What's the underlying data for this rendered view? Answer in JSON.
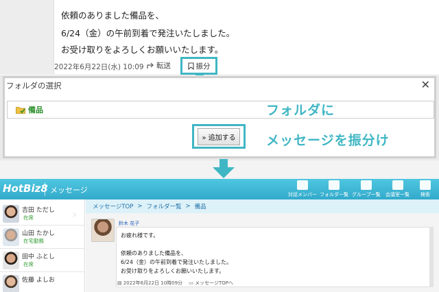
{
  "top_message": {
    "lines": [
      "依頼のありました備品を、",
      "6/24（金）の午前到着で発注いたしました。",
      "お受け取りをよろしくお願いいたします。"
    ],
    "date": "2022年6月22日(水) 10:09",
    "forward_label": "転送",
    "assign_label": "振分"
  },
  "dialog": {
    "title": "フォルダの選択",
    "close_symbol": "✕",
    "folder_name": "備品",
    "add_button": "» 追加する"
  },
  "overlay": {
    "line1": "フォルダに",
    "line2": "メッセージを振分け"
  },
  "app": {
    "logo": "HotBiz8",
    "section_title": "メッセージ",
    "nav": [
      {
        "label": "対話メンバー",
        "icon": "person-icon"
      },
      {
        "label": "フォルダ一覧",
        "icon": "folder-icon"
      },
      {
        "label": "グループ一覧",
        "icon": "group-icon"
      },
      {
        "label": "会議室一覧",
        "icon": "meeting-room-icon"
      },
      {
        "label": "検索",
        "icon": "search-icon"
      }
    ],
    "users": [
      {
        "name": "吉田 ただし",
        "status": "在席"
      },
      {
        "name": "山田 たかし",
        "status": "在宅勤務"
      },
      {
        "name": "田中 ふとし",
        "status": "在席"
      },
      {
        "name": "佐藤 よしお",
        "status": ""
      }
    ],
    "breadcrumb": [
      "メッセージTOP",
      "フォルダ一覧",
      "備品"
    ],
    "breadcrumb_sep": ">",
    "sender": "鈴木 花子",
    "message_lines": [
      "お疲れ様です。",
      "",
      "依頼のありました備品を、",
      "6/24（金）の午前到着で発注いたしました。",
      "お受け取りをよろしくお願いいたします。"
    ],
    "message_date": "2022年6月22日 10時09分",
    "message_top_link": "メッセージTOPへ"
  },
  "colors": {
    "accent": "#3fb6c4",
    "header": "#3fb0cf",
    "folder_text": "#2a8d2a"
  }
}
